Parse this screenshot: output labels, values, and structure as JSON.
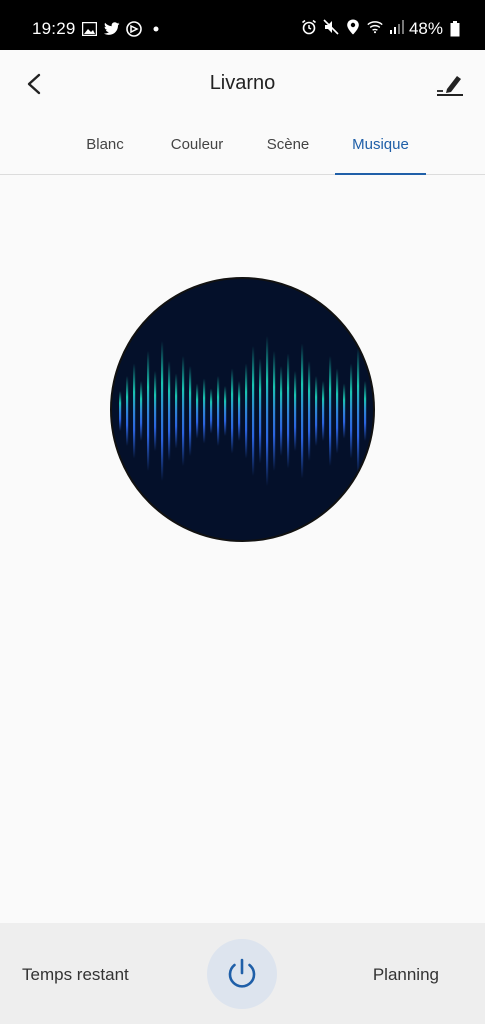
{
  "status_bar": {
    "time": "19:29",
    "battery_percent": "48%",
    "left_icons": [
      "gallery-icon",
      "twitter-icon",
      "app-icon",
      "dot-icon"
    ],
    "right_icons": [
      "alarm-icon",
      "mute-icon",
      "location-icon",
      "wifi-icon",
      "signal-icon",
      "battery-icon"
    ]
  },
  "header": {
    "title": "Livarno",
    "back_icon": "chevron-left-icon",
    "edit_icon": "edit-icon"
  },
  "tabs": [
    {
      "label": "Blanc",
      "active": false
    },
    {
      "label": "Couleur",
      "active": false
    },
    {
      "label": "Scène",
      "active": false
    },
    {
      "label": "Musique",
      "active": true
    }
  ],
  "colors": {
    "accent": "#1f5fa8",
    "visual_bg": "#04102a",
    "bar_top": "#19c4b0",
    "bar_bottom": "#2b63e0"
  },
  "bottom_bar": {
    "timer_label": "Temps restant",
    "schedule_label": "Planning",
    "power_icon": "power-icon"
  }
}
